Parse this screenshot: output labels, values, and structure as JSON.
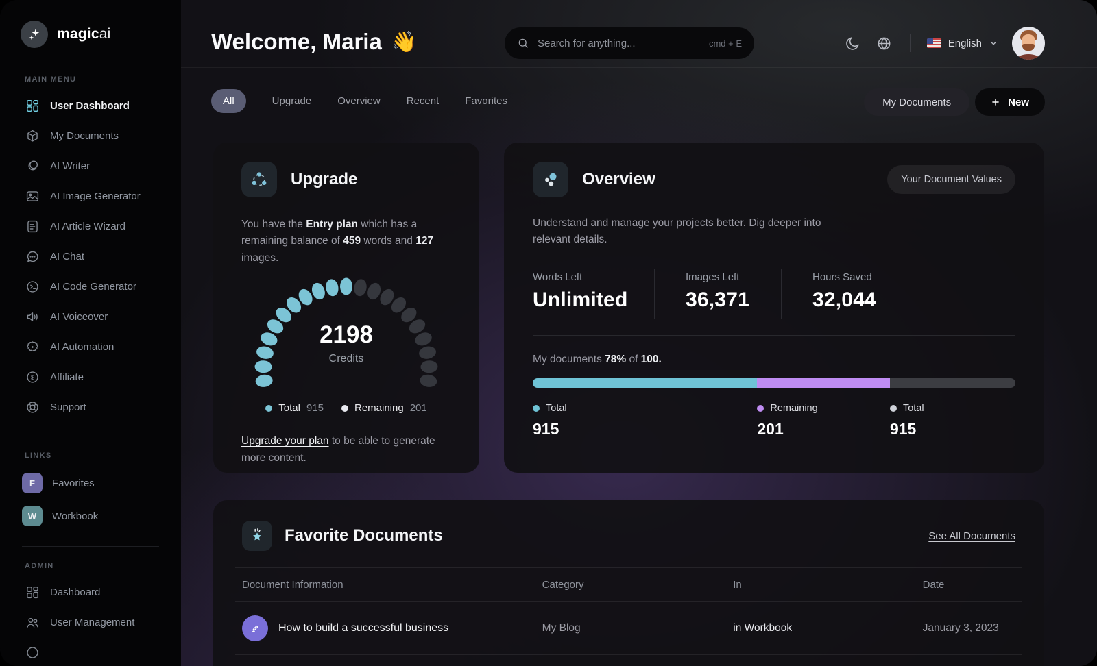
{
  "sidebar": {
    "brand_bold": "magic",
    "brand_light": "ai",
    "main_label": "MAIN MENU",
    "main_items": [
      "User Dashboard",
      "My Documents",
      "AI Writer",
      "AI Image Generator",
      "AI Article Wizard",
      "AI Chat",
      "AI Code Generator",
      "AI Voiceover",
      "AI Automation",
      "Affiliate",
      "Support"
    ],
    "links_label": "LINKS",
    "links_items": [
      {
        "badge": "F",
        "label": "Favorites"
      },
      {
        "badge": "W",
        "label": "Workbook"
      }
    ],
    "admin_label": "ADMIN",
    "admin_items": [
      "Dashboard",
      "User Management"
    ]
  },
  "header": {
    "greeting": "Welcome, Maria",
    "greeting_emoji": "👋",
    "search_placeholder": "Search for anything...",
    "search_shortcut": "cmd + E",
    "language": "English"
  },
  "tabs": {
    "items": [
      "All",
      "Upgrade",
      "Overview",
      "Recent",
      "Favorites"
    ],
    "active": "All",
    "my_documents_button": "My Documents",
    "new_button": "New"
  },
  "upgrade": {
    "title": "Upgrade",
    "desc_1": "You have the ",
    "desc_plan": "Entry plan",
    "desc_2": " which has a remaining balance of ",
    "desc_words": "459",
    "desc_3": " words and ",
    "desc_images": "127",
    "desc_4": " images.",
    "gauge": {
      "value": "2198",
      "unit": "Credits",
      "segments_total": 21,
      "segments_filled": 11,
      "filled_color": "#7cc4d6",
      "empty_color": "#35373d",
      "total_label": "Total",
      "total_value": "915",
      "total_dot_color": "#7cc4d6",
      "remaining_label": "Remaining",
      "remaining_value": "201",
      "remaining_dot_color": "#e8e9ef"
    },
    "link": "Upgrade your plan",
    "link_suffix": " to be able to generate more content."
  },
  "overview": {
    "title": "Overview",
    "values_button": "Your Document Values",
    "description": "Understand and manage your projects better. Dig deeper into relevant details.",
    "stats": [
      {
        "label": "Words Left",
        "value": "Unlimited"
      },
      {
        "label": "Images Left",
        "value": "36,371"
      },
      {
        "label": "Hours Saved",
        "value": "32,044"
      }
    ],
    "progress_prefix": "My documents ",
    "progress_pct": "78%",
    "progress_of": " of ",
    "progress_total": "100.",
    "bar": {
      "segments": [
        {
          "label": "Total",
          "value": "915",
          "color": "#6fc3d6",
          "dot_color": "#6fc3d6",
          "width_pct": 46.5,
          "legend_left_pct": 0
        },
        {
          "label": "Remaining",
          "value": "201",
          "color": "#bf8cf2",
          "dot_color": "#bf8cf2",
          "width_pct": 27.5,
          "legend_left_pct": 46.5
        },
        {
          "label": "Total",
          "value": "915",
          "color": "#3c3d42",
          "dot_color": "#cfd2d9",
          "width_pct": 26,
          "legend_left_pct": 74
        }
      ]
    }
  },
  "favorites": {
    "title": "Favorite Documents",
    "see_all": "See All Documents",
    "columns": [
      "Document Information",
      "Category",
      "In",
      "Date"
    ],
    "rows": [
      {
        "title": "How to build a successful business",
        "category": "My Blog",
        "location": "in Workbook",
        "date": "January 3, 2023"
      }
    ]
  }
}
